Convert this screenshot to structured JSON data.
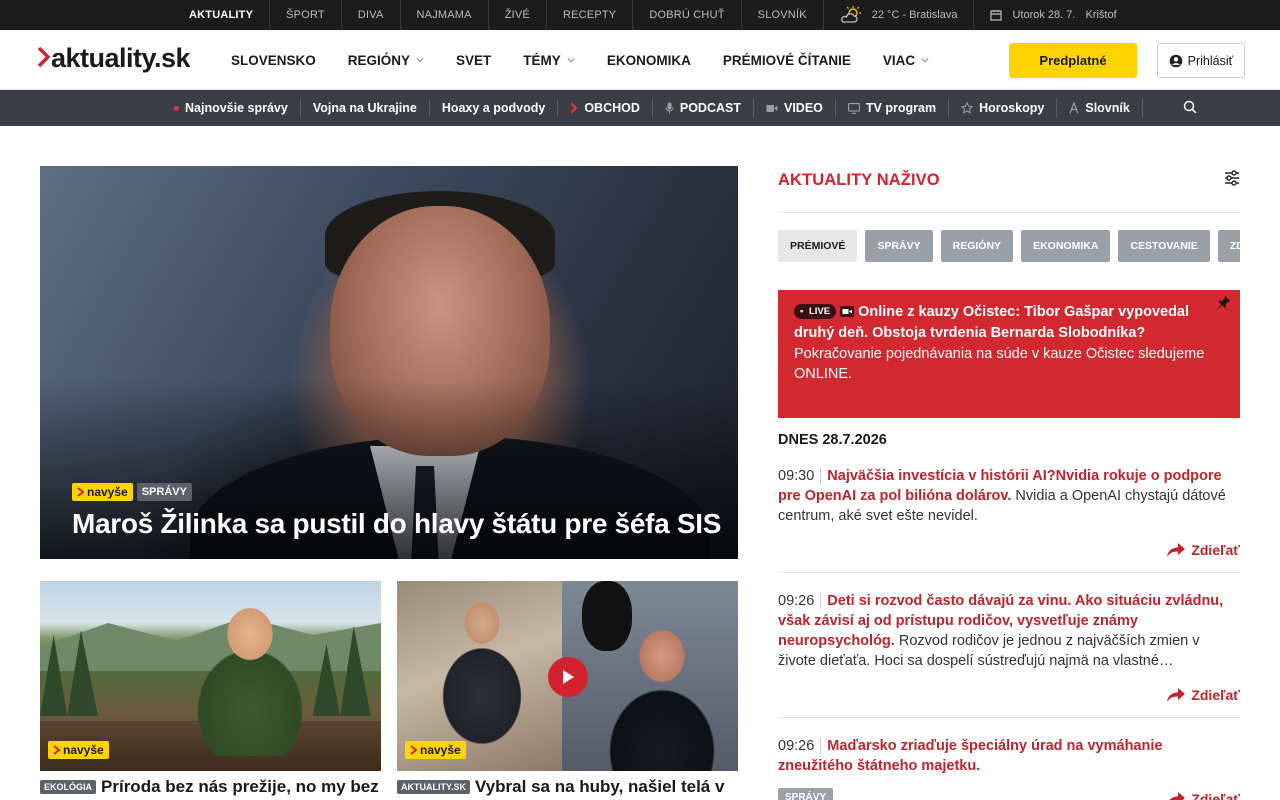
{
  "topbar": {
    "items": [
      {
        "label": "Aktuality",
        "active": true
      },
      {
        "label": "Šport"
      },
      {
        "label": "Diva"
      },
      {
        "label": "Najmama"
      },
      {
        "label": "Živé"
      },
      {
        "label": "Recepty"
      },
      {
        "label": "Dobrú chuť"
      },
      {
        "label": "Slovník"
      }
    ],
    "weather": "22 °C - Bratislava",
    "date": "Utorok 28. 7.",
    "nameday": "Krištof"
  },
  "header": {
    "logo": "aktuality.sk",
    "nav": [
      {
        "label": "Slovensko"
      },
      {
        "label": "Regióny",
        "dropdown": true
      },
      {
        "label": "Svet"
      },
      {
        "label": "Témy",
        "dropdown": true
      },
      {
        "label": "Ekonomika"
      },
      {
        "label": "Prémiové čítanie"
      },
      {
        "label": "Viac",
        "dropdown": true
      }
    ],
    "subscribe": "Predplatné",
    "login": "Prihlásiť"
  },
  "subnav": {
    "items": [
      {
        "label": "Najnovšie správy",
        "icon": "red-dot-icon"
      },
      {
        "label": "Vojna na Ukrajine"
      },
      {
        "label": "Hoaxy a podvody"
      },
      {
        "label": "OBCHOD",
        "icon": "chevron-brand-icon"
      },
      {
        "label": "PODCAST",
        "icon": "microphone-icon"
      },
      {
        "label": "VIDEO",
        "icon": "video-camera-icon"
      },
      {
        "label": "TV program",
        "icon": "tv-icon"
      },
      {
        "label": "Horoskopy",
        "icon": "star-icon"
      },
      {
        "label": "Slovník",
        "icon": "letter-a-icon"
      }
    ]
  },
  "hero": {
    "badge": "navyše",
    "category": "Správy",
    "title": "Maroš Žilinka sa pustil do hlavy štátu pre šéfa SIS"
  },
  "cards": [
    {
      "badge": "navyše",
      "category": "Ekológia",
      "title": "Príroda bez nás prežije, no my bez nej"
    },
    {
      "badge": "navyše",
      "category": "aktuality.sk",
      "title": "Vybral sa na huby, našiel telá v"
    }
  ],
  "sidebar": {
    "title": "Aktuality naživo",
    "chips": [
      {
        "label": "Prémiové",
        "active": true
      },
      {
        "label": "Správy"
      },
      {
        "label": "Regióny"
      },
      {
        "label": "Ekonomika"
      },
      {
        "label": "Cestovanie"
      },
      {
        "label": "Zdr"
      }
    ],
    "live": {
      "badge": "LIVE",
      "title": "Online z kauzy Očistec: Tibor Gašpar vypovedal druhý deň. Obstoja tvrdenia Bernarda Slobodníka?",
      "desc": "Pokračovanie pojednávania na súde v kauze Očistec sledujeme ONLINE."
    },
    "day": "DNES 28.7.2026",
    "items": [
      {
        "time": "09:30",
        "headline": "Najväčšia investícia v histórii AI?Nvidia rokuje o podpore pre OpenAI za pol bilióna dolárov.",
        "text": " Nvidia a OpenAI chystajú dátové centrum, aké svet ešte nevidel.",
        "share": "Zdieľať"
      },
      {
        "time": "09:26",
        "headline": "Deti si rozvod často dávajú za vinu. Ako situáciu zvládnu, však závisí aj od prístupu rodičov, vysvetľuje známy neuropsychológ.",
        "text": " Rozvod rodičov je jednou z najväčších zmien v živote dieťaťa. Hoci sa dospelí sústreďujú najmä na vlastné…",
        "share": "Zdieľať"
      },
      {
        "time": "09:26",
        "headline": "Maďarsko zriaďuje špeciálny úrad na vymáhanie zneužitého štátneho majetku.",
        "text": "",
        "category": "Správy",
        "share": "Zdieľať"
      }
    ]
  },
  "colors": {
    "brand_red": "#d2222d",
    "subscribe_yellow": "#ffd400",
    "topbar": "#1c1c1c",
    "subnav": "#3b3f45"
  }
}
